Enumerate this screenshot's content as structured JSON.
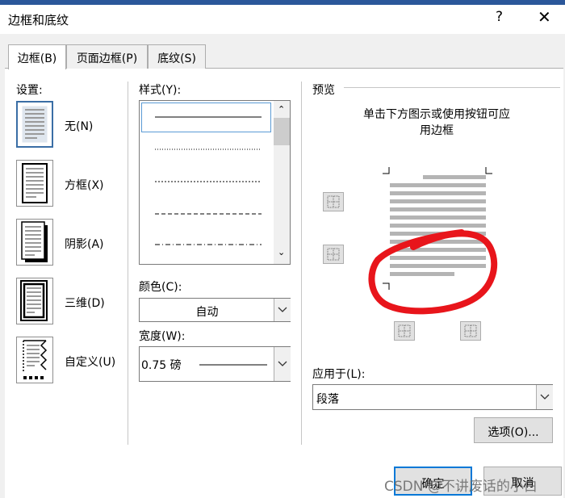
{
  "dialog": {
    "title": "边框和底纹",
    "help": "?",
    "close": "✕"
  },
  "tabs": [
    "边框(B)",
    "页面边框(P)",
    "底纹(S)"
  ],
  "settings": {
    "label": "设置:",
    "items": [
      "无(N)",
      "方框(X)",
      "阴影(A)",
      "三维(D)",
      "自定义(U)"
    ]
  },
  "style": {
    "label": "样式(Y):"
  },
  "color": {
    "label": "颜色(C):",
    "value": "自动"
  },
  "width": {
    "label": "宽度(W):",
    "value": "0.75 磅"
  },
  "preview": {
    "label": "预览",
    "hint_line1": "单击下方图示或使用按钮可应",
    "hint_line2": "用边框"
  },
  "apply": {
    "label": "应用于(L):",
    "value": "段落"
  },
  "buttons": {
    "options": "选项(O)...",
    "ok": "确定",
    "cancel": "取消"
  },
  "watermark": "CSDN @不讲废话的小白",
  "colors": {
    "accent": "#2b579a",
    "annotation": "#e8151b"
  }
}
